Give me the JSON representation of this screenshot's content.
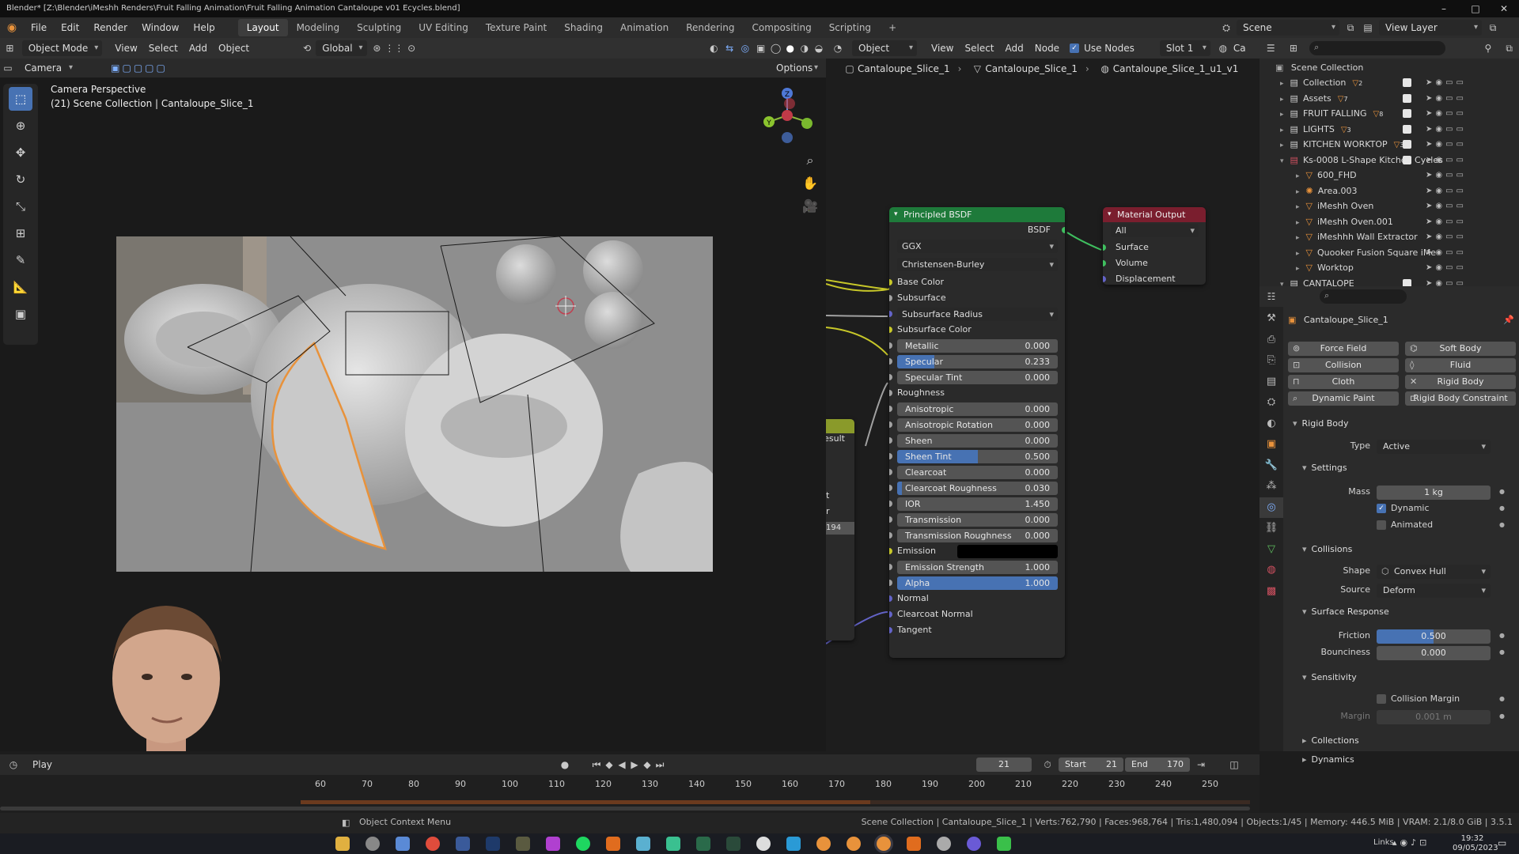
{
  "window": {
    "title": "Blender* [Z:\\Blender\\iMeshh Renders\\Fruit Falling Animation\\Fruit Falling Animation Cantaloupe v01 Ecycles.blend]",
    "minimize": "–",
    "maximize": "□",
    "close": "✕"
  },
  "menu": [
    "File",
    "Edit",
    "Render",
    "Window",
    "Help"
  ],
  "workspaces": [
    "Layout",
    "Modeling",
    "Sculpting",
    "UV Editing",
    "Texture Paint",
    "Shading",
    "Animation",
    "Rendering",
    "Compositing",
    "Scripting"
  ],
  "active_workspace": "Layout",
  "add_workspace": "+",
  "scene": {
    "label": "Scene",
    "view_layer": "View Layer"
  },
  "viewport": {
    "mode": "Object Mode",
    "menus": [
      "View",
      "Select",
      "Add",
      "Object"
    ],
    "orientation": "Global",
    "options": "Options",
    "camera_menu": "Camera",
    "overlay_title": "Camera Perspective",
    "overlay_subtitle": "(21) Scene Collection | Cantaloupe_Slice_1",
    "gizmo": {
      "x": "X",
      "y": "Y",
      "z": "Z"
    }
  },
  "node_editor": {
    "object_type": "Object",
    "menus": [
      "View",
      "Select",
      "Add",
      "Node"
    ],
    "use_nodes_label": "Use Nodes",
    "slot": "Slot 1",
    "partial_tab": "Ca",
    "breadcrumb": [
      "Cantaloupe_Slice_1",
      "Cantaloupe_Slice_1",
      "Cantaloupe_Slice_1_u1_v1"
    ],
    "partial_node": {
      "result": "Result",
      "t": "t",
      "r": "r",
      "value": "194"
    },
    "principled": {
      "title": "Principled BSDF",
      "output": "BSDF",
      "distribution": "GGX",
      "subsurface_method": "Christensen-Burley",
      "rows": [
        {
          "label": "Base Color",
          "type": "socket",
          "color": "#c7c729"
        },
        {
          "label": "Subsurface",
          "type": "socket",
          "color": "#a1a1a1"
        },
        {
          "label": "Subsurface Radius",
          "type": "select",
          "color": "#6363c7"
        },
        {
          "label": "Subsurface Color",
          "type": "socket",
          "color": "#c7c729"
        },
        {
          "label": "Metallic",
          "type": "field",
          "value": "0.000",
          "fill": 0.0
        },
        {
          "label": "Specular",
          "type": "field",
          "value": "0.233",
          "fill": 0.233
        },
        {
          "label": "Specular Tint",
          "type": "field",
          "value": "0.000",
          "fill": 0.0
        },
        {
          "label": "Roughness",
          "type": "socket",
          "color": "#a1a1a1"
        },
        {
          "label": "Anisotropic",
          "type": "field",
          "value": "0.000",
          "fill": 0.0
        },
        {
          "label": "Anisotropic Rotation",
          "type": "field",
          "value": "0.000",
          "fill": 0.0
        },
        {
          "label": "Sheen",
          "type": "field",
          "value": "0.000",
          "fill": 0.0
        },
        {
          "label": "Sheen Tint",
          "type": "field",
          "value": "0.500",
          "fill": 0.5
        },
        {
          "label": "Clearcoat",
          "type": "field",
          "value": "0.000",
          "fill": 0.0
        },
        {
          "label": "Clearcoat Roughness",
          "type": "field",
          "value": "0.030",
          "fill": 0.03
        },
        {
          "label": "IOR",
          "type": "field",
          "value": "1.450",
          "fill": 0.0
        },
        {
          "label": "Transmission",
          "type": "field",
          "value": "0.000",
          "fill": 0.0
        },
        {
          "label": "Transmission Roughness",
          "type": "field",
          "value": "0.000",
          "fill": 0.0
        },
        {
          "label": "Emission",
          "type": "color",
          "color": "#c7c729"
        },
        {
          "label": "Emission Strength",
          "type": "field",
          "value": "1.000",
          "fill": 0.0
        },
        {
          "label": "Alpha",
          "type": "field",
          "value": "1.000",
          "fill": 1.0
        },
        {
          "label": "Normal",
          "type": "socket",
          "color": "#6363c7"
        },
        {
          "label": "Clearcoat Normal",
          "type": "socket",
          "color": "#6363c7"
        },
        {
          "label": "Tangent",
          "type": "socket",
          "color": "#6363c7"
        }
      ]
    },
    "material_output": {
      "title": "Material Output",
      "target": "All",
      "inputs": [
        "Surface",
        "Volume",
        "Displacement"
      ]
    }
  },
  "outliner": {
    "root": "Scene Collection",
    "items": [
      {
        "label": "Collection",
        "indent": 1,
        "expand": "▸",
        "badge": "2",
        "kind": "collection"
      },
      {
        "label": "Assets",
        "indent": 1,
        "expand": "▸",
        "badge": "7",
        "kind": "collection"
      },
      {
        "label": "FRUIT FALLING",
        "indent": 1,
        "expand": "▸",
        "badge": "8",
        "kind": "collection"
      },
      {
        "label": "LIGHTS",
        "indent": 1,
        "expand": "▸",
        "badge": "3",
        "kind": "collection"
      },
      {
        "label": "KITCHEN WORKTOP",
        "indent": 1,
        "expand": "▸",
        "badge": "3",
        "kind": "collection"
      },
      {
        "label": "Ks-0008 L-Shape Kitchen Cycles",
        "indent": 1,
        "expand": "▾",
        "badge": "",
        "kind": "collection-red"
      },
      {
        "label": "600_FHD",
        "indent": 2,
        "expand": "▸",
        "badge": "",
        "kind": "object"
      },
      {
        "label": "Area.003",
        "indent": 2,
        "expand": "▸",
        "badge": "",
        "kind": "light"
      },
      {
        "label": "iMeshh Oven",
        "indent": 2,
        "expand": "▸",
        "badge": "",
        "kind": "object"
      },
      {
        "label": "iMeshh Oven.001",
        "indent": 2,
        "expand": "▸",
        "badge": "",
        "kind": "object"
      },
      {
        "label": "iMeshhh Wall Extractor",
        "indent": 2,
        "expand": "▸",
        "badge": "",
        "kind": "object"
      },
      {
        "label": "Quooker Fusion Square iMe",
        "indent": 2,
        "expand": "▸",
        "badge": "",
        "kind": "object"
      },
      {
        "label": "Worktop",
        "indent": 2,
        "expand": "▸",
        "badge": "",
        "kind": "object"
      },
      {
        "label": "CANTALOPE",
        "indent": 1,
        "expand": "▾",
        "badge": "",
        "kind": "collection"
      }
    ]
  },
  "properties": {
    "object_name": "Cantaloupe_Slice_1",
    "physics_buttons": [
      {
        "label": "Force Field",
        "icon": "⊚"
      },
      {
        "label": "Soft Body",
        "icon": "⌬"
      },
      {
        "label": "Collision",
        "icon": "⊡"
      },
      {
        "label": "Fluid",
        "icon": "◊"
      },
      {
        "label": "Cloth",
        "icon": "⊓"
      },
      {
        "label": "Rigid Body",
        "icon": "✕"
      },
      {
        "label": "Dynamic Paint",
        "icon": "⌕"
      },
      {
        "label": "Rigid Body Constraint",
        "icon": "⊏"
      }
    ],
    "rigid_body": {
      "title": "Rigid Body",
      "type_label": "Type",
      "type_value": "Active",
      "settings_title": "Settings",
      "mass_label": "Mass",
      "mass_value": "1 kg",
      "dynamic_label": "Dynamic",
      "dynamic": true,
      "animated_label": "Animated",
      "animated": false,
      "collisions_title": "Collisions",
      "shape_label": "Shape",
      "shape_value": "Convex Hull",
      "source_label": "Source",
      "source_value": "Deform",
      "surface_title": "Surface Response",
      "friction_label": "Friction",
      "friction_value": "0.500",
      "friction_fill": 0.5,
      "bounciness_label": "Bounciness",
      "bounciness_value": "0.000",
      "sensitivity_title": "Sensitivity",
      "collision_margin_label": "Collision Margin",
      "margin_label": "Margin",
      "margin_value": "0.001 m",
      "collections_title": "Collections",
      "dynamics_title": "Dynamics"
    }
  },
  "timeline": {
    "playback": "Play",
    "current_frame": "21",
    "start_label": "Start",
    "start": "21",
    "end_label": "End",
    "end": "170",
    "ticks": [
      "60",
      "70",
      "80",
      "90",
      "100",
      "110",
      "120",
      "130",
      "140",
      "150",
      "160",
      "170",
      "180",
      "190",
      "200",
      "210",
      "220",
      "230",
      "240",
      "250"
    ]
  },
  "statusbar": {
    "left": "Object Context Menu",
    "right": "Scene Collection | Cantaloupe_Slice_1 | Verts:762,790 | Faces:968,764 | Tris:1,480,094 | Objects:1/45 | Memory: 446.5 MiB | VRAM: 2.1/8.0 GiB | 3.5.1"
  },
  "taskbar": {
    "links": "Links",
    "time": "19:32",
    "date": "09/05/2023"
  },
  "colors": {
    "accent": "#4772b3",
    "selection_outline": "#e8923b",
    "bsdf_header": "#1e7a3a",
    "output_header": "#7a1e2e",
    "yellow_socket": "#c7c729",
    "violet_socket": "#6363c7"
  }
}
